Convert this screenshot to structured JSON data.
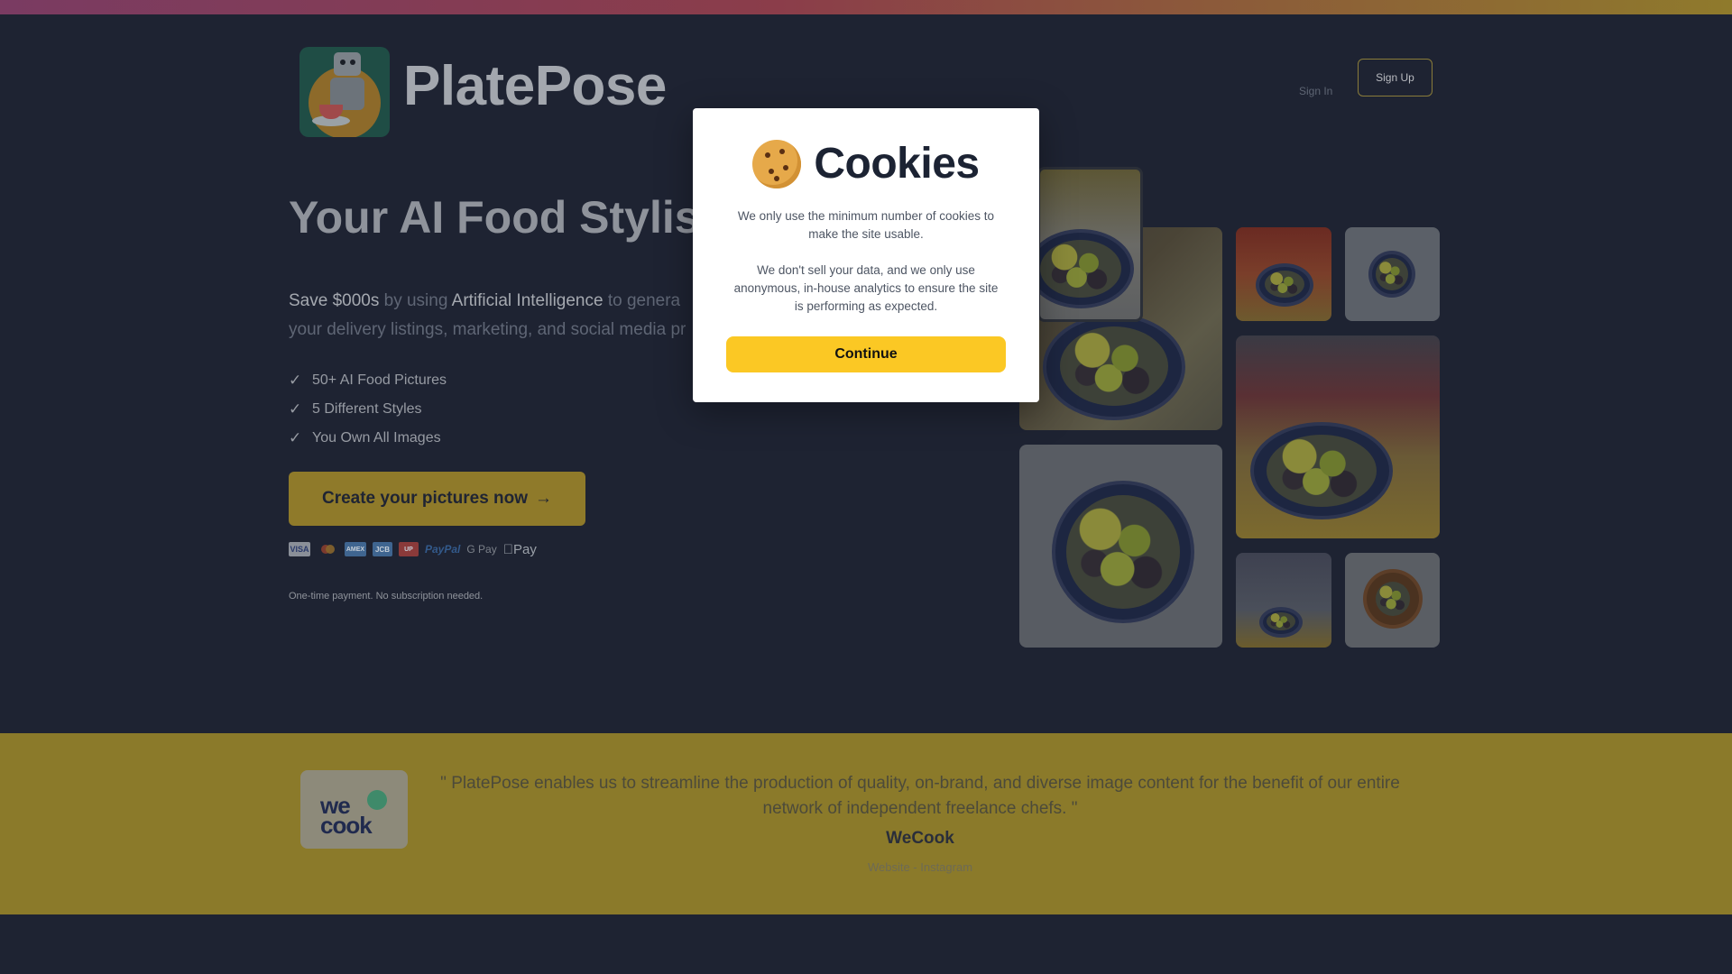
{
  "header": {
    "brand_name": "PlatePose",
    "sign_in": "Sign In",
    "sign_up": "Sign Up"
  },
  "hero": {
    "title": "Your AI Food Stylist",
    "subtitle_prefix": "Save $000s",
    "subtitle_mid": " by using ",
    "subtitle_ai": "Artificial Intelligence",
    "subtitle_rest": " to genera",
    "subtitle_line2": "your delivery listings, marketing, and social media pr",
    "features": [
      "50+ AI Food Pictures",
      "5 Different Styles",
      "You Own All Images"
    ],
    "check_glyph": "✓",
    "cta_label": "Create your pictures now",
    "cta_arrow": "→",
    "payment_methods": [
      "VISA",
      "Mastercard",
      "AMEX",
      "JCB",
      "UnionPay",
      "PayPal",
      "G Pay",
      "Pay"
    ],
    "payment_labels": {
      "visa": "VISA",
      "amex": "AMEX",
      "jcb": "JCB",
      "union": "UP",
      "paypal": "PayPal",
      "gpay": "G Pay",
      "apple": "Pay"
    },
    "payment_note": "One-time payment. No subscription needed."
  },
  "testimonial": {
    "logo_text_line1": "we",
    "logo_text_line2": "cook",
    "quote": "\" PlatePose enables us to streamline the production of quality, on-brand, and diverse image content for the benefit of our entire network of independent freelance chefs. \"",
    "author": "WeCook",
    "links": "Website - Instagram"
  },
  "cookie_modal": {
    "title": "Cookies",
    "paragraph_1": "We only use the minimum number of cookies to make the site usable.",
    "paragraph_2": "We don't sell your data, and we only use anonymous, in-house analytics to ensure the site is performing as expected.",
    "continue_label": "Continue"
  },
  "colors": {
    "accent_yellow": "#fbc824",
    "page_bg": "#2d3547",
    "testimonial_bg": "#e6c73a"
  }
}
